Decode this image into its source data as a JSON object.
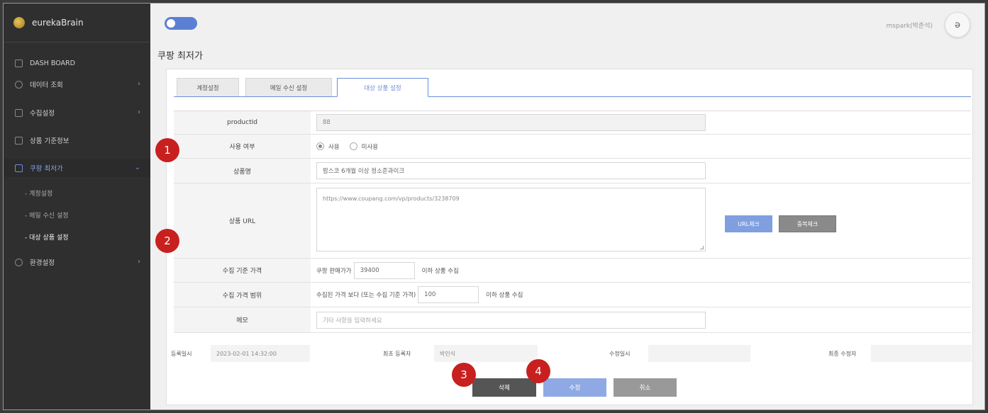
{
  "sidebar": {
    "brand": "eurekaBrain",
    "items": [
      {
        "label": "DASH BOARD",
        "arrow": ""
      },
      {
        "label": "데이터 조회",
        "arrow": "›"
      },
      {
        "label": "수집설정",
        "arrow": "›"
      },
      {
        "label": "상품 기준정보",
        "arrow": ""
      },
      {
        "label": "쿠팡 최저가",
        "arrow": "⌄"
      },
      {
        "label": "환경설정",
        "arrow": "›"
      }
    ],
    "sub_items": [
      {
        "label": "- 계정설정"
      },
      {
        "label": "- 메일 수신 설정"
      },
      {
        "label": "- 대상 상품 설정"
      }
    ]
  },
  "header": {
    "user_name": "mspark(박준석)",
    "user_icon": "ə"
  },
  "page": {
    "title": "쿠팡 최저가"
  },
  "tabs": [
    {
      "label": "계정설정"
    },
    {
      "label": "메일 수신 설정"
    },
    {
      "label": "대상 상품 설정"
    }
  ],
  "form": {
    "product_id_label": "productId",
    "product_id_value": "88",
    "use_label": "사용 여부",
    "use_option_on": "사용",
    "use_option_off": "미사용",
    "name_label": "상품명",
    "name_value": "팜스코 6개월 이상 청소준과이크",
    "url_label": "상품 URL",
    "url_value": "https://www.coupang.com/vp/products/3238709",
    "url_check_button": "URL체크",
    "dup_check_button": "중복체크",
    "base_price_label": "수집 기준 가격",
    "base_price_prefix": "쿠팡 판매가가",
    "base_price_value": "39400",
    "base_price_suffix": "이하 상품 수집",
    "range_label": "수집 가격 범위",
    "range_prefix": "수집된 가격 보다 (또는 수집 기준 가격)",
    "range_value": "100",
    "range_suffix": "이하 상품 수집",
    "memo_label": "메모",
    "memo_placeholder": "기타 사항을 입력하세요"
  },
  "meta": {
    "reg_date_label": "등록일시",
    "reg_date_value": "2023-02-01 14:32:00",
    "first_reg_label": "최초 등록자",
    "first_reg_value": "박민식",
    "mod_date_label": "수정일시",
    "mod_date_value": "",
    "last_mod_label": "최종 수정자",
    "last_mod_value": ""
  },
  "buttons": {
    "delete": "삭제",
    "edit": "수정",
    "cancel": "취소"
  },
  "badges": [
    "1",
    "2",
    "3",
    "4"
  ],
  "colors": {
    "accent": "#6b8ed6",
    "sidebar_bg": "#2f2f2f",
    "badge": "#c8201f"
  }
}
